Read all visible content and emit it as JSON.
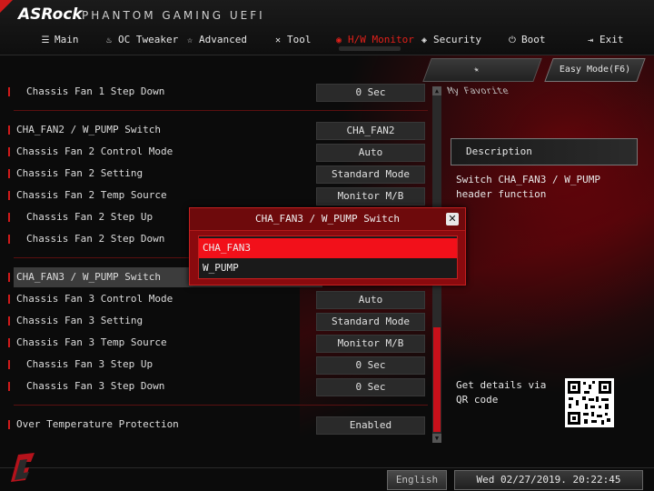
{
  "header": {
    "brand": "ASRock",
    "brand_sub": "PHANTOM GAMING UEFI",
    "nav": [
      {
        "label": "Main",
        "icon": "list-icon"
      },
      {
        "label": "OC Tweaker",
        "icon": "flame-icon"
      },
      {
        "label": "Advanced",
        "icon": "star-icon"
      },
      {
        "label": "Tool",
        "icon": "tools-icon"
      },
      {
        "label": "H/W Monitor",
        "icon": "monitor-icon",
        "active": true
      },
      {
        "label": "Security",
        "icon": "shield-icon"
      },
      {
        "label": "Boot",
        "icon": "power-icon"
      },
      {
        "label": "Exit",
        "icon": "exit-icon"
      }
    ]
  },
  "top_buttons": {
    "favorite": "My Favorite",
    "easy_mode": "Easy Mode(F6)"
  },
  "settings": [
    {
      "label": "Chassis Fan 1 Step Down",
      "value": "0 Sec",
      "indent": true
    },
    {
      "label": "CHA_FAN2 / W_PUMP Switch",
      "value": "CHA_FAN2",
      "indent": false
    },
    {
      "label": "Chassis Fan 2 Control Mode",
      "value": "Auto",
      "indent": false
    },
    {
      "label": "Chassis Fan 2 Setting",
      "value": "Standard Mode",
      "indent": false
    },
    {
      "label": "Chassis Fan 2 Temp Source",
      "value": "Monitor M/B",
      "indent": false
    },
    {
      "label": "Chassis Fan 2 Step Up",
      "value": "",
      "indent": true
    },
    {
      "label": "Chassis Fan 2 Step Down",
      "value": "",
      "indent": true
    },
    {
      "label": "CHA_FAN3 / W_PUMP Switch",
      "value": "",
      "indent": false,
      "selected": true
    },
    {
      "label": "Chassis Fan 3 Control Mode",
      "value": "Auto",
      "indent": false
    },
    {
      "label": "Chassis Fan 3 Setting",
      "value": "Standard Mode",
      "indent": false
    },
    {
      "label": "Chassis Fan 3 Temp Source",
      "value": "Monitor M/B",
      "indent": false
    },
    {
      "label": "Chassis Fan 3 Step Up",
      "value": "0 Sec",
      "indent": true
    },
    {
      "label": "Chassis Fan 3 Step Down",
      "value": "0 Sec",
      "indent": true
    },
    {
      "label": "Over Temperature Protection",
      "value": "Enabled",
      "indent": false
    }
  ],
  "description": {
    "title": "Description",
    "text": "Switch CHA_FAN3 / W_PUMP header function",
    "qr_text": "Get details via QR code"
  },
  "popup": {
    "title": "CHA_FAN3 / W_PUMP Switch",
    "options": [
      "CHA_FAN3",
      "W_PUMP"
    ],
    "highlighted_option": "CHA_FAN3"
  },
  "footer": {
    "language": "English",
    "datetime": "Wed 02/27/2019. 20:22:45"
  },
  "colors": {
    "accent": "#d01a1a",
    "highlight": "#f2101a",
    "popup_bg": "#8a0a0e"
  }
}
